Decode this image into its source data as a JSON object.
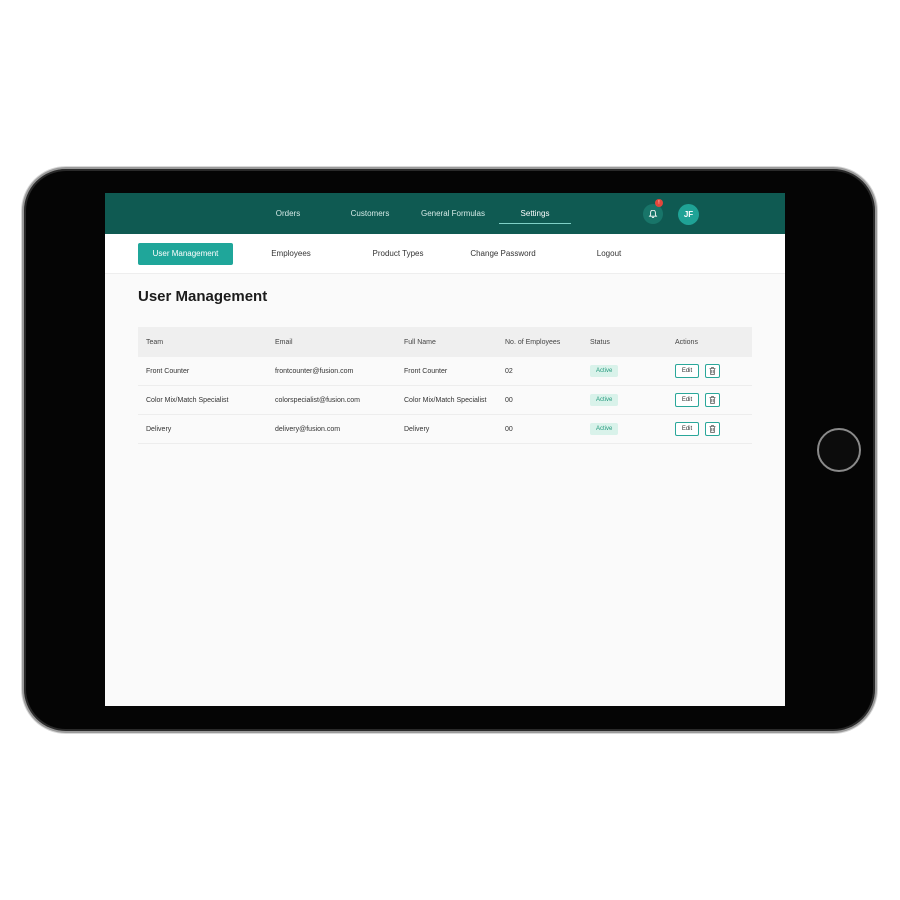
{
  "nav": {
    "items": [
      "Orders",
      "Customers",
      "General Formulas",
      "Settings"
    ],
    "active": "Settings",
    "notification_count": "!",
    "avatar_initials": "JF"
  },
  "subnav": {
    "items": [
      "User Management",
      "Employees",
      "Product Types",
      "Change Password",
      "Logout"
    ],
    "active": "User Management"
  },
  "page": {
    "title": "User Management"
  },
  "table": {
    "columns": [
      "Team",
      "Email",
      "Full Name",
      "No. of Employees",
      "Status",
      "Actions"
    ],
    "rows": [
      {
        "team": "Front Counter",
        "email": "frontcounter@fusion.com",
        "full_name": "Front Counter",
        "employees": "02",
        "status": "Active",
        "edit": "Edit"
      },
      {
        "team": "Color Mix/Match Specialist",
        "email": "colorspecialist@fusion.com",
        "full_name": "Color Mix/Match Specialist",
        "employees": "00",
        "status": "Active",
        "edit": "Edit"
      },
      {
        "team": "Delivery",
        "email": "delivery@fusion.com",
        "full_name": "Delivery",
        "employees": "00",
        "status": "Active",
        "edit": "Edit"
      }
    ]
  },
  "colors": {
    "topbar": "#0f5a52",
    "accent": "#1fa69a",
    "badge_bg": "#d9f2ea",
    "badge_text": "#23997c",
    "notification": "#e2463b"
  }
}
